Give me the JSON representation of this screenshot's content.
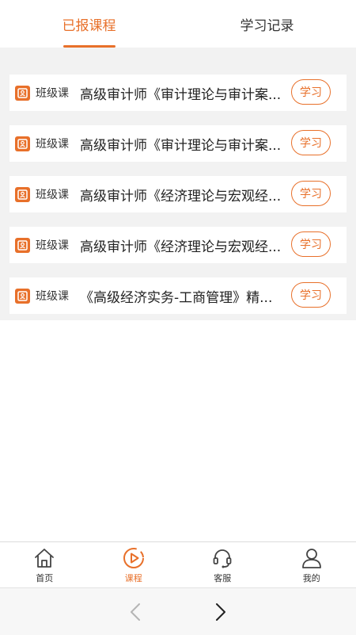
{
  "tabs": [
    {
      "label": "已报课程"
    },
    {
      "label": "学习记录"
    }
  ],
  "courses": [
    {
      "type": "班级课",
      "title": "高级审计师《审计理论与审计案...",
      "action": "学习"
    },
    {
      "type": "班级课",
      "title": "高级审计师《审计理论与审计案...",
      "action": "学习"
    },
    {
      "type": "班级课",
      "title": "高级审计师《经济理论与宏观经...",
      "action": "学习"
    },
    {
      "type": "班级课",
      "title": "高级审计师《经济理论与宏观经...",
      "action": "学习"
    },
    {
      "type": "班级课",
      "title": "《高级经济实务-工商管理》精...",
      "action": "学习"
    }
  ],
  "nav": [
    {
      "label": "首页",
      "icon": "home-icon"
    },
    {
      "label": "课程",
      "icon": "play-circle-icon"
    },
    {
      "label": "客服",
      "icon": "headset-icon"
    },
    {
      "label": "我的",
      "icon": "user-icon"
    }
  ],
  "colors": {
    "accent": "#e8702a",
    "background": "#f2f2f2"
  }
}
